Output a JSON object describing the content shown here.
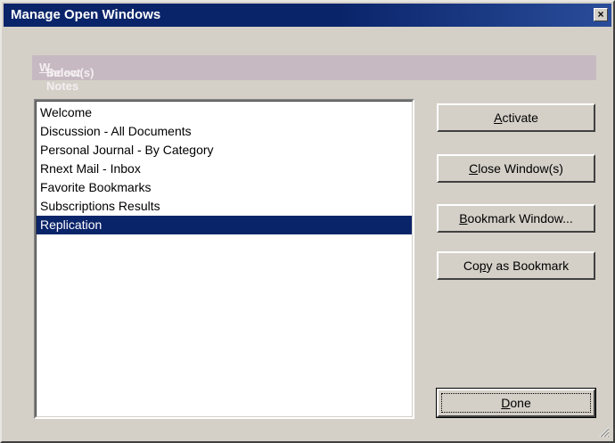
{
  "window": {
    "title": "Manage Open Windows",
    "close_glyph": "×"
  },
  "section": {
    "header_before": "Select Notes ",
    "header_accel": "W",
    "header_after": "indow(s)"
  },
  "list": {
    "items": [
      {
        "label": "Welcome",
        "selected": false
      },
      {
        "label": "Discussion - All Documents",
        "selected": false
      },
      {
        "label": "Personal Journal - By Category",
        "selected": false
      },
      {
        "label": "Rnext Mail - Inbox",
        "selected": false
      },
      {
        "label": "Favorite Bookmarks",
        "selected": false
      },
      {
        "label": "Subscriptions Results",
        "selected": false
      },
      {
        "label": "Replication",
        "selected": true
      }
    ]
  },
  "buttons": {
    "activate": {
      "before": "",
      "accel": "A",
      "after": "ctivate"
    },
    "close_windows": {
      "before": "",
      "accel": "C",
      "after": "lose Window(s)"
    },
    "bookmark_window": {
      "before": "",
      "accel": "B",
      "after": "ookmark Window..."
    },
    "copy_as_bookmark": {
      "before": "Co",
      "accel": "p",
      "after": "y as Bookmark"
    },
    "done": {
      "before": "",
      "accel": "D",
      "after": "one"
    }
  },
  "colors": {
    "title_bar": "#0a246a",
    "dialog_face": "#d4d0c8",
    "section_header": "#c7b9c1",
    "selection": "#0a246a"
  },
  "icons": {
    "close": "close-icon",
    "resize": "resize-grip-icon"
  }
}
